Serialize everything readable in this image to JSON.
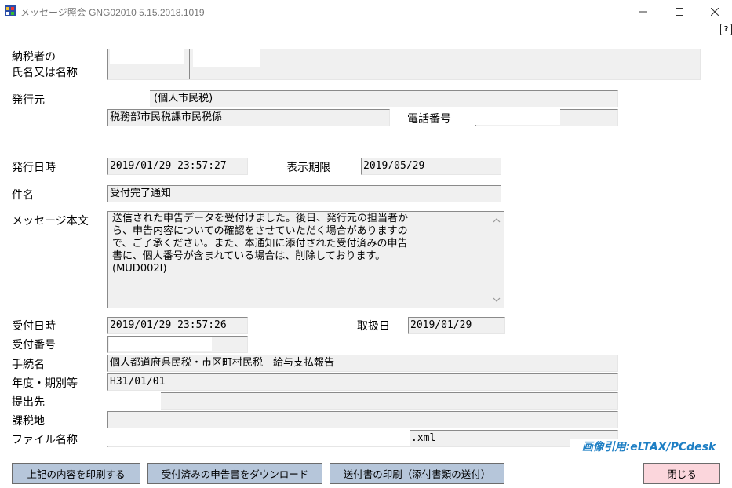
{
  "window": {
    "title": "メッセージ照会 GNG02010  5.15.2018.1019",
    "help_glyph": "?"
  },
  "labels": {
    "taxpayer_line1": "納税者の",
    "taxpayer_line2": "氏名又は名称",
    "issuer": "発行元",
    "phone": "電話番号",
    "issue_datetime": "発行日時",
    "display_limit": "表示期限",
    "subject": "件名",
    "message_body": "メッセージ本文",
    "received_datetime": "受付日時",
    "handled_date": "取扱日",
    "receipt_number": "受付番号",
    "procedure_name": "手続名",
    "fiscal_period": "年度・期別等",
    "submitted_to": "提出先",
    "taxation_place": "課税地",
    "file_name": "ファイル名称"
  },
  "values": {
    "issuer_name_suffix": "(個人市民税)",
    "issuer_department": "税務部市民税課市民税係",
    "issue_datetime": "2019/01/29 23:57:27",
    "display_limit": "2019/05/29",
    "subject": "受付完了通知",
    "message_body": "送信された申告データを受付けました。後日、発行元の担当者か\nら、申告内容についての確認をさせていただく場合がありますの\nで、ご了承ください。また、本通知に添付された受付済みの申告\n書に、個人番号が含まれている場合は、削除しております。\n(MUD002I)",
    "received_datetime": "2019/01/29 23:57:26",
    "handled_date": "2019/01/29",
    "procedure_name": "個人都道府県民税・市区町村民税　給与支払報告",
    "fiscal_period": "H31/01/01",
    "file_name_suffix": ".xml"
  },
  "buttons": {
    "print_contents": "上記の内容を印刷する",
    "download_received": "受付済みの申告書をダウンロード",
    "print_cover": "送付書の印刷（添付書類の送付）",
    "close": "閉じる"
  },
  "credit": "画像引用:eLTAX/PCdesk",
  "colors": {
    "field_bg": "#f0f0f0",
    "button_bg": "#b6c6da",
    "close_button_bg": "#fbd6dc",
    "credit_text": "#1e7fc4"
  }
}
